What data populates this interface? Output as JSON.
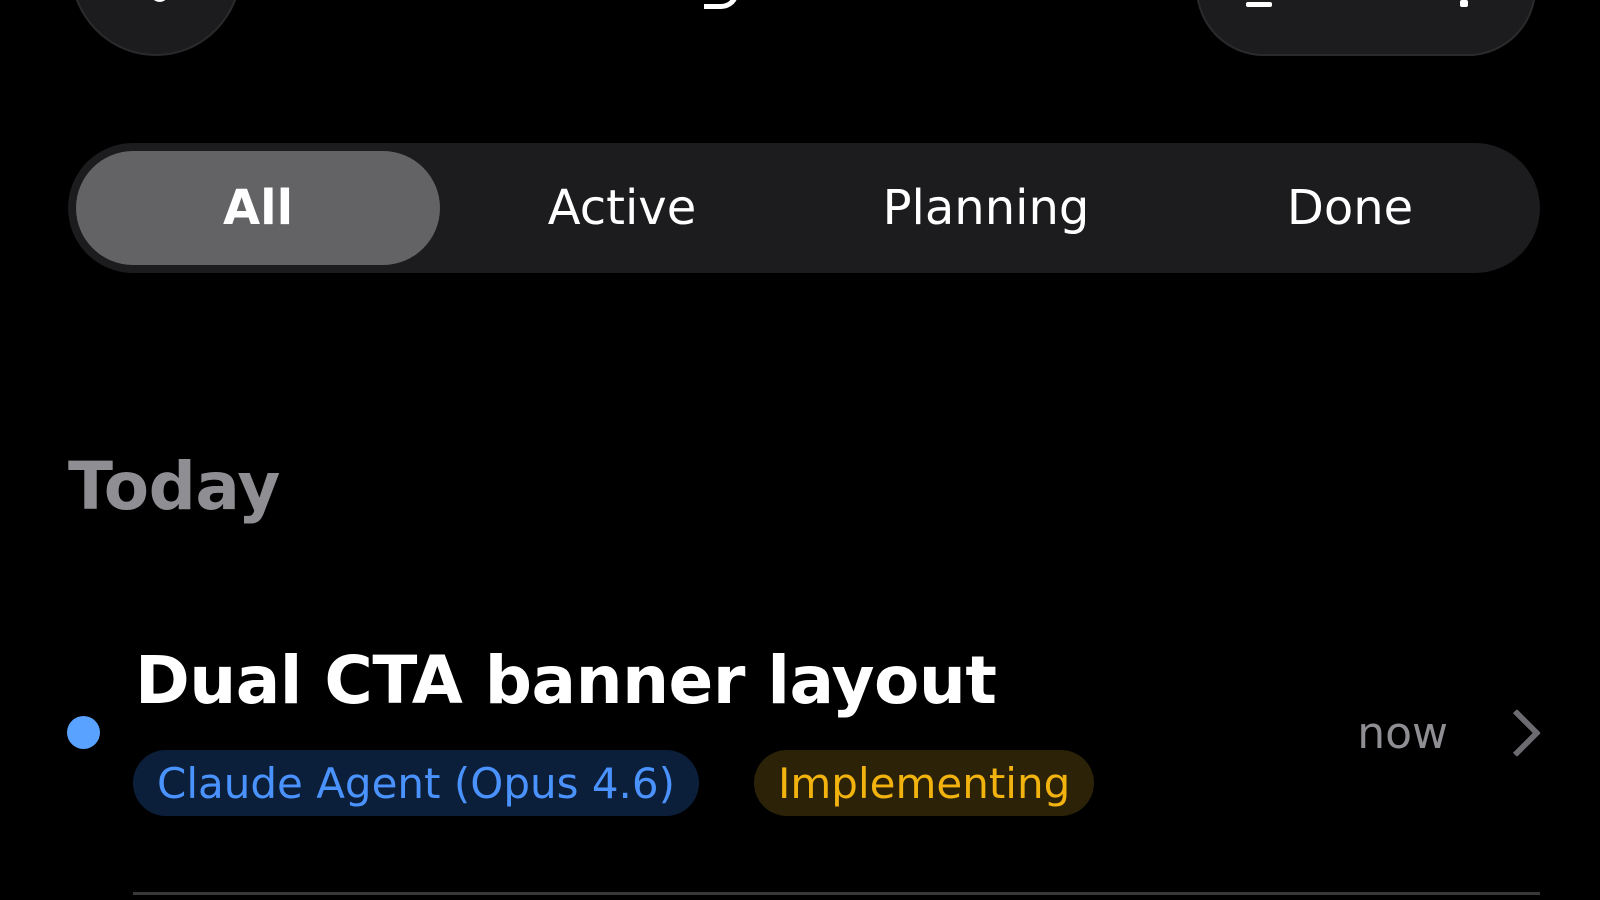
{
  "tabs": [
    {
      "label": "All",
      "selected": true
    },
    {
      "label": "Active",
      "selected": false
    },
    {
      "label": "Planning",
      "selected": false
    },
    {
      "label": "Done",
      "selected": false
    }
  ],
  "section": {
    "title": "Today"
  },
  "items": [
    {
      "title": "Dual CTA banner layout",
      "agent_label": "Claude Agent (Opus 4.6)",
      "status_label": "Implementing",
      "time": "now",
      "dot_color": "#5aa2ff"
    }
  ],
  "colors": {
    "background": "#000000",
    "segment_bg": "#1c1c1e",
    "segment_selected": "#636366",
    "agent_chip_text": "#4a93ff",
    "status_chip_text": "#f2b30f",
    "muted_text": "#8e8e93"
  },
  "icons": [
    "back-button-icon",
    "chevron-right-icon"
  ]
}
